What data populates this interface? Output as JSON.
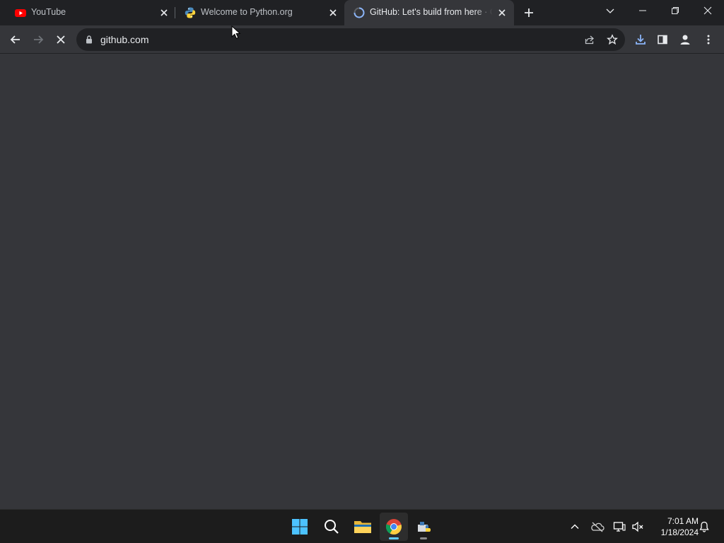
{
  "browser": {
    "tabs": [
      {
        "title": "YouTube",
        "favicon": "youtube-icon",
        "active": false
      },
      {
        "title": "Welcome to Python.org",
        "favicon": "python-icon",
        "active": false
      },
      {
        "title": "GitHub: Let's build from here · Gi",
        "favicon": "loading-spinner-icon",
        "active": true
      }
    ],
    "new_tab": "plus-icon",
    "url": "github.com",
    "loading": true
  },
  "taskbar": {
    "apps": [
      "windows-start-icon",
      "search-icon",
      "file-explorer-icon",
      "chrome-icon",
      "python-installer-icon"
    ],
    "clock": {
      "time": "7:01 AM",
      "date": "1/18/2024"
    }
  },
  "colors": {
    "tabstrip": "#202124",
    "toolbar": "#35363a",
    "content": "#35363a",
    "taskbar": "#1c1c1c",
    "accent": "#8ab4f8"
  }
}
